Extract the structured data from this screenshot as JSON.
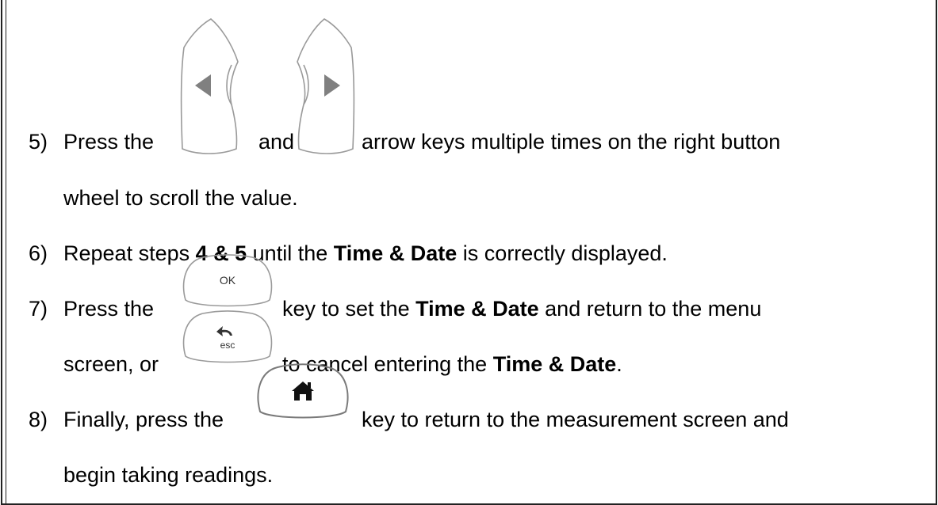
{
  "steps": [
    {
      "number": "5)",
      "line1": {
        "a": "Press the",
        "b": "and",
        "c": "arrow keys multiple times on the right button"
      },
      "line2": "wheel to scroll the value."
    },
    {
      "number": "6)",
      "a": "Repeat steps ",
      "b_bold": "4 & 5",
      "c": " until the ",
      "d_bold": "Time & Date",
      "e": " is correctly displayed."
    },
    {
      "number": "7)",
      "line1": {
        "a": "Press the",
        "b": "key to set the ",
        "c_bold": "Time & Date",
        "d": " and return to the menu"
      },
      "line2": {
        "a": "screen, or",
        "b": "to cancel entering the ",
        "c_bold": "Time & Date",
        "d": "."
      }
    },
    {
      "number": "8)",
      "line1": {
        "a": "Finally, press the",
        "b": "key to return to the measurement screen and"
      },
      "line2": "begin taking readings."
    }
  ],
  "keys": {
    "ok_label": "OK",
    "esc_label": "esc",
    "left_icon": "left-arrow-icon",
    "right_icon": "right-arrow-icon",
    "home_icon": "home-icon",
    "back_icon": "back-arrow-icon"
  },
  "colors": {
    "key_outline": "#9a9a9a",
    "arrow_fill": "#808080",
    "text": "#000000"
  }
}
